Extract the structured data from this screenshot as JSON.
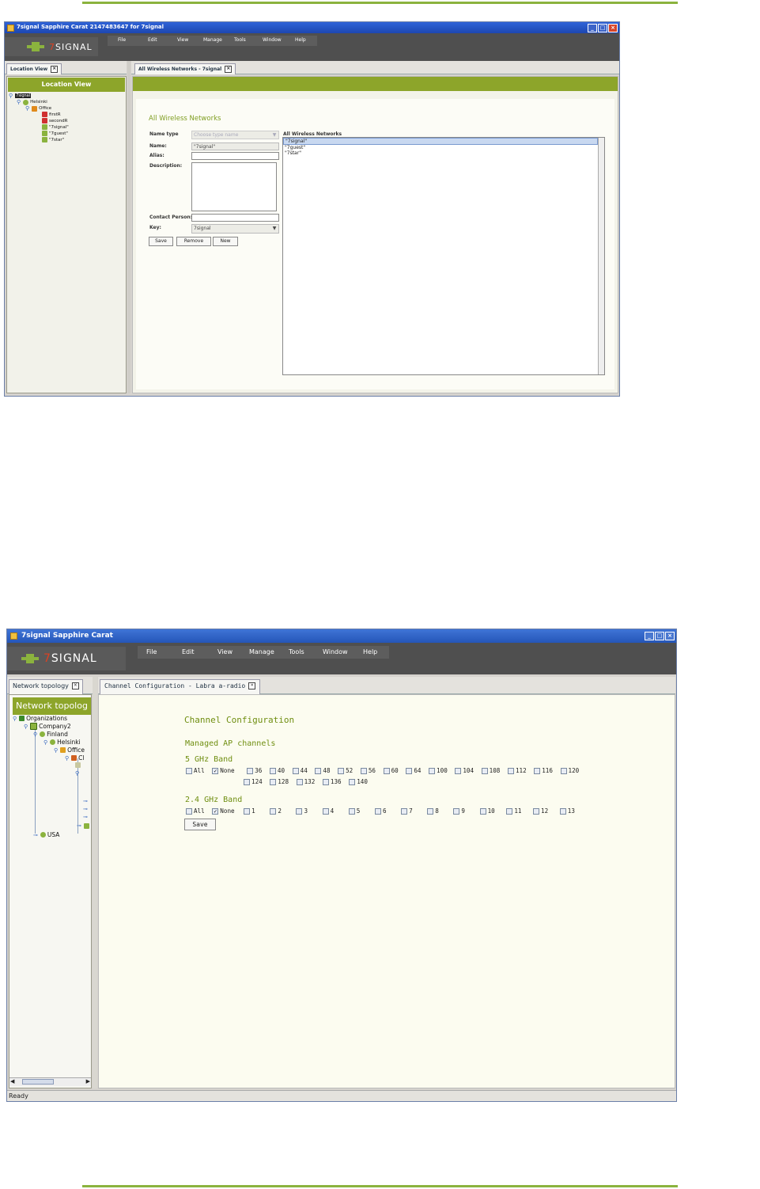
{
  "screenshot1": {
    "window_title": "7signal Sapphire Carat  2147483647 for 7signal",
    "logo_text_a": "7",
    "logo_text_b": "SIGNAL",
    "menu": [
      "File",
      "Edit",
      "View",
      "Manage",
      "Tools",
      "Window",
      "Help"
    ],
    "left_tab": "Location View",
    "right_tab": "All Wireless Networks - 7signal",
    "left_header": "Location View",
    "tree": [
      "7signal",
      "Helsinki",
      "Office",
      "firstR",
      "secondR",
      "\"7signal\"",
      "\"7guest\"",
      "\"7star\""
    ],
    "form_title": "All Wireless Networks",
    "labels": {
      "name_type": "Name type",
      "name": "Name:",
      "alias": "Alias:",
      "description": "Description:",
      "contact_person": "Contact Person:",
      "key": "Key:"
    },
    "values": {
      "name_type_placeholder": "Choose type name",
      "name": "\"7signal\"",
      "alias": "",
      "description": "",
      "contact_person": "",
      "key": "7signal"
    },
    "buttons": {
      "save": "Save",
      "remove": "Remove",
      "new": "New"
    },
    "list_label": "All Wireless Networks",
    "list_items": [
      "\"7signal\"",
      "\"7guest\"",
      "\"7star\""
    ]
  },
  "screenshot2": {
    "window_title": "7signal Sapphire Carat",
    "logo_text_a": "7",
    "logo_text_b": "SIGNAL",
    "menu": [
      "File",
      "Edit",
      "View",
      "Manage",
      "Tools",
      "Window",
      "Help"
    ],
    "left_tab": "Network topology",
    "right_tab": "Channel Configuration - Labra a-radio",
    "left_header": "Network topolog",
    "tree": [
      "Organizations",
      "Company2",
      "Finland",
      "Helsinki",
      "Office",
      "Cl",
      "USA"
    ],
    "title": "Channel Configuration",
    "managed_label": "Managed AP channels",
    "band5_label": "5 GHz Band",
    "band24_label": "2.4 GHz Band",
    "all_label": "All",
    "none_label": "None",
    "band5_row1": [
      "36",
      "40",
      "44",
      "48",
      "52",
      "56",
      "60",
      "64",
      "100",
      "104",
      "108",
      "112",
      "116",
      "120"
    ],
    "band5_row2": [
      "124",
      "128",
      "132",
      "136",
      "140"
    ],
    "band24": [
      "1",
      "2",
      "3",
      "4",
      "5",
      "6",
      "7",
      "8",
      "9",
      "10",
      "11",
      "12",
      "13"
    ],
    "save_label": "Save",
    "status": "Ready"
  },
  "colors": {
    "accent_green": "#8bb33e",
    "header_green": "#8da52a",
    "banner": "#4f4f4f",
    "title_blue": "#2a56c6"
  }
}
